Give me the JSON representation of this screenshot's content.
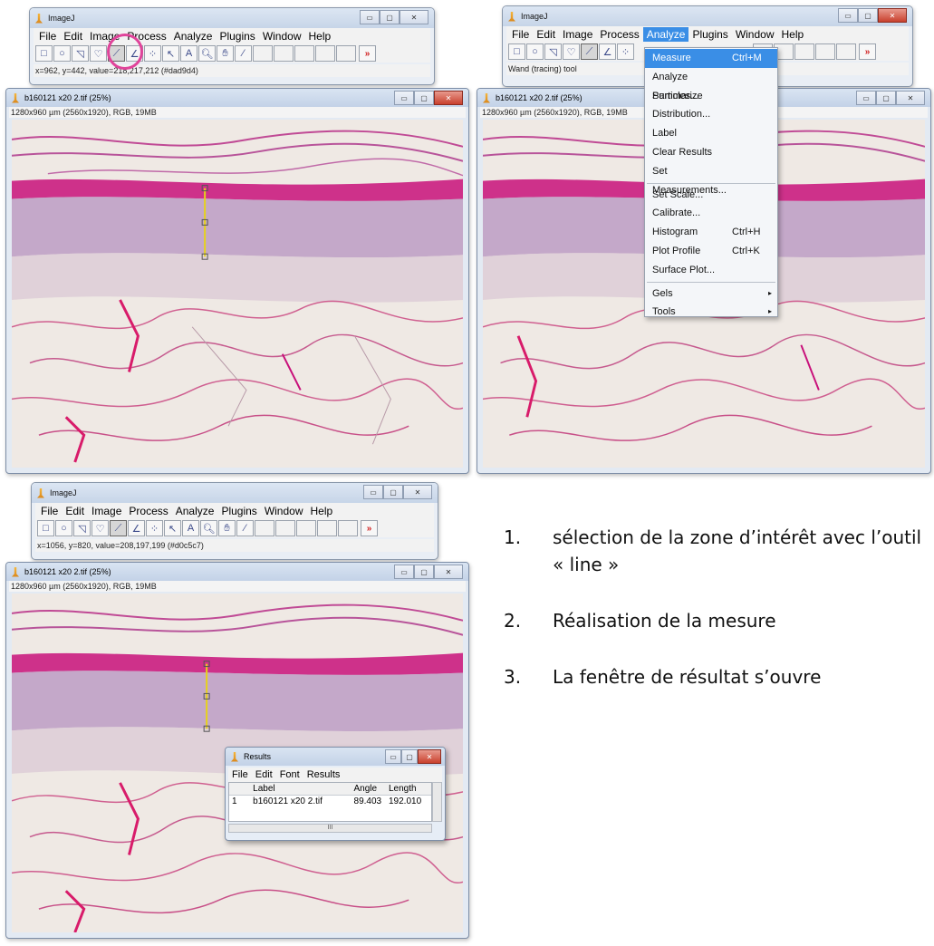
{
  "app_title": "ImageJ",
  "menus": [
    "File",
    "Edit",
    "Image",
    "Process",
    "Analyze",
    "Plugins",
    "Window",
    "Help"
  ],
  "status": {
    "top_left": "x=962, y=442, value=218,217,212 (#dad9d4)",
    "top_right": "Wand (tracing) tool",
    "bottom": "x=1056, y=820, value=208,197,199 (#d0c5c7)"
  },
  "image_window": {
    "title": "b160121 x20 2.tif (25%)",
    "info": "1280x960 µm (2560x1920), RGB, 19MB"
  },
  "analyze_menu": {
    "items": [
      {
        "label": "Measure",
        "shortcut": "Ctrl+M",
        "highlighted": true
      },
      {
        "label": "Analyze Particles...",
        "shortcut": ""
      },
      {
        "label": "Summarize",
        "shortcut": ""
      },
      {
        "label": "Distribution...",
        "shortcut": ""
      },
      {
        "label": "Label",
        "shortcut": ""
      },
      {
        "label": "Clear Results",
        "shortcut": ""
      },
      {
        "label": "Set Measurements...",
        "shortcut": ""
      },
      {
        "label": "Set Scale...",
        "shortcut": ""
      },
      {
        "label": "Calibrate...",
        "shortcut": ""
      },
      {
        "label": "Histogram",
        "shortcut": "Ctrl+H"
      },
      {
        "label": "Plot Profile",
        "shortcut": "Ctrl+K"
      },
      {
        "label": "Surface Plot...",
        "shortcut": ""
      },
      {
        "label": "Gels",
        "shortcut": "",
        "submenu": true
      },
      {
        "label": "Tools",
        "shortcut": "",
        "submenu": true
      }
    ]
  },
  "results": {
    "title": "Results",
    "menus": [
      "File",
      "Edit",
      "Font",
      "Results"
    ],
    "columns": [
      "",
      "Label",
      "Angle",
      "Length"
    ],
    "row": [
      "1",
      "b160121 x20 2.tif",
      "89.403",
      "192.010"
    ],
    "scroll_mark": "III"
  },
  "steps": [
    {
      "num": "1.",
      "text": "sélection de la zone d’intérêt avec l’outil « line »"
    },
    {
      "num": "2.",
      "text": "Réalisation de la mesure"
    },
    {
      "num": "3.",
      "text": "La fenêtre de résultat s’ouvre"
    }
  ],
  "tools": [
    "rect-icon",
    "oval-icon",
    "polygon-icon",
    "freehand-icon",
    "line-icon",
    "angle-icon",
    "point-icon",
    "wand-icon",
    "text-icon",
    "magnifier-icon",
    "hand-icon",
    "dropper-icon"
  ],
  "colors": {
    "menu_highlight": "#3a8ee6",
    "marker_circle": "#e0449a",
    "tissue_pink": "#c8107a",
    "tissue_purple": "#8a5aa8"
  }
}
